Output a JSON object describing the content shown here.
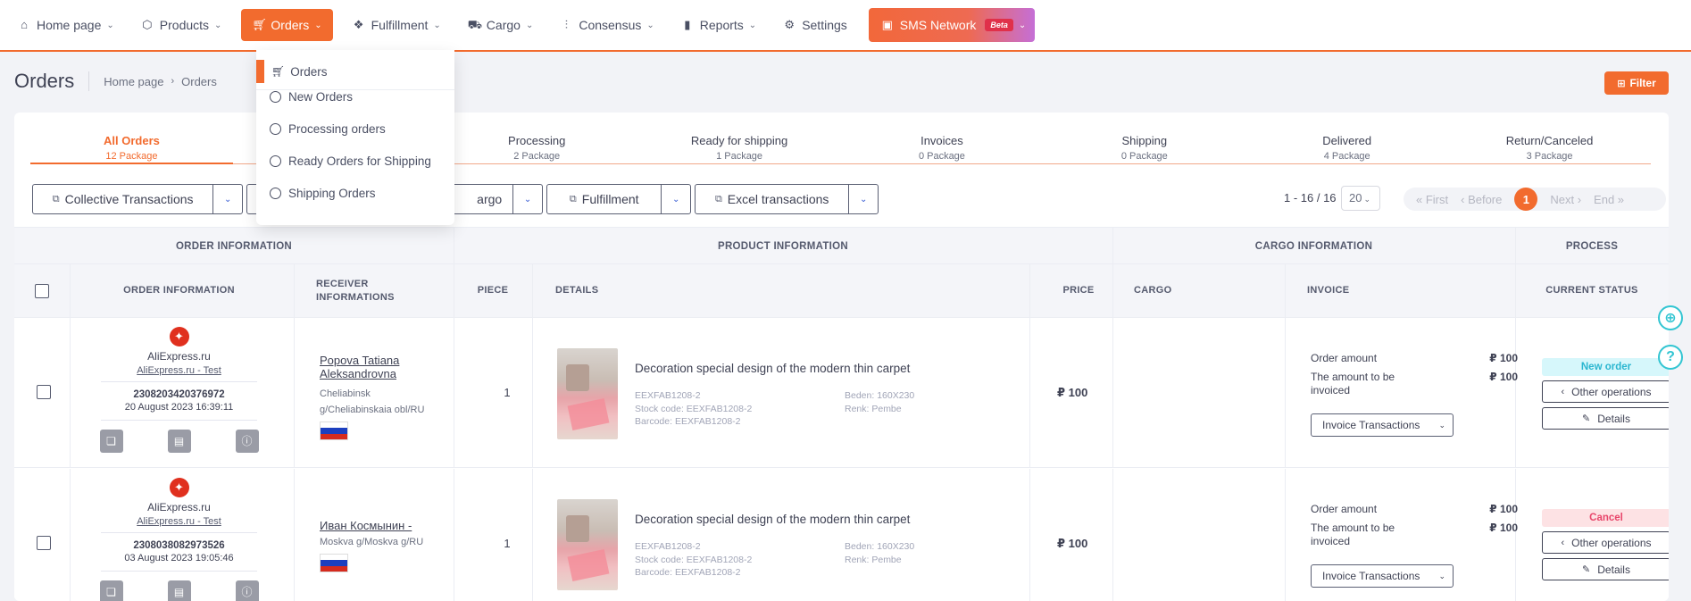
{
  "nav": {
    "items": [
      {
        "label": "Home page",
        "icon": "home-icon"
      },
      {
        "label": "Products",
        "icon": "box-icon"
      },
      {
        "label": "Orders",
        "icon": "cart-icon"
      },
      {
        "label": "Fulfillment",
        "icon": "fulfillment-icon"
      },
      {
        "label": "Cargo",
        "icon": "truck-icon"
      },
      {
        "label": "Consensus",
        "icon": "sliders-icon"
      },
      {
        "label": "Reports",
        "icon": "bar-chart-icon"
      },
      {
        "label": "Settings",
        "icon": "gear-icon"
      }
    ],
    "sms_label": "SMS Network",
    "beta_label": "Beta",
    "accent_color": "#f26b2e"
  },
  "orders_menu": {
    "title": "Orders",
    "items": [
      "New Orders",
      "Processing orders",
      "Ready Orders for Shipping",
      "Shipping Orders"
    ]
  },
  "page": {
    "title": "Orders",
    "breadcrumb": [
      "Home page",
      "Orders"
    ],
    "filter_label": "Filter"
  },
  "tabs": [
    {
      "label": "All Orders",
      "count": "12 Package"
    },
    {
      "label": "",
      "count": ""
    },
    {
      "label": "Processing",
      "count": "2 Package"
    },
    {
      "label": "Ready for shipping",
      "count": "1 Package"
    },
    {
      "label": "Invoices",
      "count": "0 Package"
    },
    {
      "label": "Shipping",
      "count": "0 Package"
    },
    {
      "label": "Delivered",
      "count": "4 Package"
    },
    {
      "label": "Return/Canceled",
      "count": "3 Package"
    }
  ],
  "toolbar": {
    "collective": "Collective Transactions",
    "cargo": "argo",
    "fulfillment": "Fulfillment",
    "excel": "Excel transactions"
  },
  "pagination": {
    "range": "1 - 16 / 16",
    "per_page": "20",
    "first": "« First",
    "before": "‹ Before",
    "current": "1",
    "next": "Next ›",
    "end": "End »"
  },
  "table": {
    "groups": [
      "ORDER INFORMATION",
      "PRODUCT INFORMATION",
      "CARGO INFORMATION",
      "PROCESS"
    ],
    "columns": {
      "order_info": "ORDER INFORMATION",
      "receiver": "RECEIVER INFORMATIONS",
      "piece": "PIECE",
      "details": "DETAILS",
      "price": "PRICE",
      "cargo": "CARGO",
      "invoice": "INVOICE",
      "status": "CURRENT STATUS"
    },
    "rows": [
      {
        "store": "AliExpress.ru",
        "store_link": "AliExpress.ru - Test",
        "order_no": "2308203420376972",
        "date": "20 August 2023 16:39:11",
        "receiver_name": "Popova Tatiana Aleksandrovna",
        "receiver_addr": "Cheliabinsk g/Cheliabinskaia obl/RU",
        "piece": "1",
        "product": "Decoration special design of the modern thin carpet",
        "sku": "EEXFAB1208-2",
        "stock_code": "Stock code: EEXFAB1208-2",
        "barcode": "Barcode: EEXFAB1208-2",
        "size": "Beden: 160X230",
        "color": "Renk: Pembe",
        "price": "₽ 100",
        "order_amount_label": "Order amount",
        "order_amount": "₽ 100",
        "invoiced_label": "The amount to be invoiced",
        "invoiced": "₽ 100",
        "invoice_btn": "Invoice Transactions",
        "status": "New order",
        "other_ops": "Other operations",
        "details_btn": "Details"
      },
      {
        "store": "AliExpress.ru",
        "store_link": "AliExpress.ru - Test",
        "order_no": "2308038082973526",
        "date": "03 August 2023 19:05:46",
        "receiver_name": "Иван Космынин -",
        "receiver_addr": "Moskva g/Moskva g/RU",
        "piece": "1",
        "product": "Decoration special design of the modern thin carpet",
        "sku": "EEXFAB1208-2",
        "stock_code": "Stock code: EEXFAB1208-2",
        "barcode": "Barcode: EEXFAB1208-2",
        "size": "Beden: 160X230",
        "color": "Renk: Pembe",
        "price": "₽ 100",
        "order_amount_label": "Order amount",
        "order_amount": "₽ 100",
        "invoiced_label": "The amount to be invoiced",
        "invoiced": "₽ 100",
        "invoice_btn": "Invoice Transactions",
        "status": "Cancel",
        "other_ops": "Other operations",
        "details_btn": "Details"
      }
    ]
  }
}
